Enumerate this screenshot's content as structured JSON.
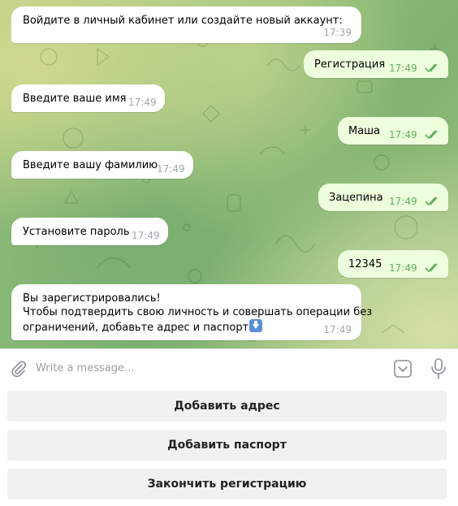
{
  "messages": [
    {
      "dir": "in",
      "text": "Войдите в личный кабинет или создайте новый аккаунт:",
      "time": "17:39"
    },
    {
      "dir": "out",
      "text": "Регистрация",
      "time": "17:49",
      "read": true
    },
    {
      "dir": "in",
      "text": "Введите ваше имя",
      "time": "17:49"
    },
    {
      "dir": "out",
      "text": "Маша",
      "time": "17:49",
      "read": true
    },
    {
      "dir": "in",
      "text": "Введите вашу фамилию",
      "time": "17:49"
    },
    {
      "dir": "out",
      "text": "Зацепина",
      "time": "17:49",
      "read": true
    },
    {
      "dir": "in",
      "text": "Установите пароль",
      "time": "17:49"
    },
    {
      "dir": "out",
      "text": "12345",
      "time": "17:49",
      "read": true
    },
    {
      "dir": "in",
      "lines": [
        "Вы зарегистрировались!",
        "Чтобы подтвердить свою личность и совершать операции без",
        "ограничений, добавьте адрес и паспорт"
      ],
      "emoji": "down-arrow-emoji",
      "time": "17:49"
    }
  ],
  "composer": {
    "placeholder": "Write a message...",
    "attach_icon": "paperclip-icon",
    "keyboard_icon": "bot-keyboard-icon",
    "mic_icon": "microphone-icon"
  },
  "keyboard": {
    "buttons": [
      "Добавить адрес",
      "Добавить паспорт",
      "Закончить регистрацию"
    ]
  },
  "colors": {
    "incoming_bubble": "#ffffff",
    "outgoing_bubble": "#eeffde",
    "outgoing_time": "#5fb05a",
    "read_ticks": "#5fb05a",
    "keyboard_button": "#f1f1f1"
  }
}
